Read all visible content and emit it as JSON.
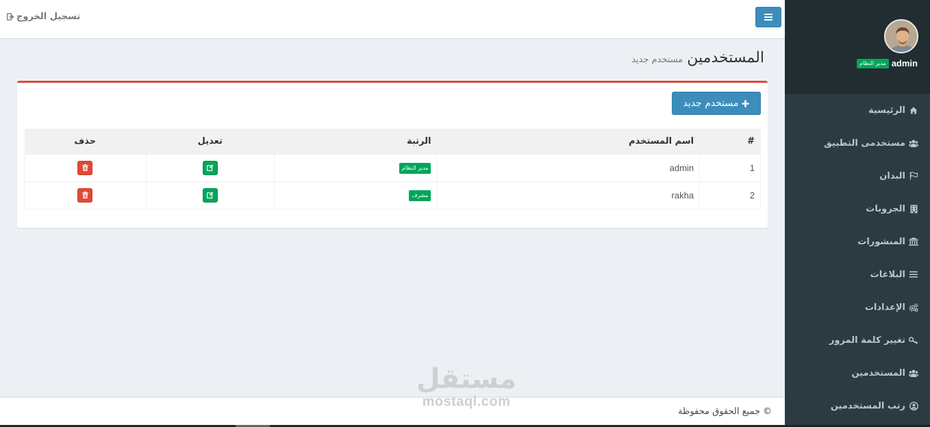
{
  "header": {
    "logout_label": "تسجيل الخروج"
  },
  "sidebar": {
    "user": {
      "name": "admin",
      "role_badge": "مدير النظام"
    },
    "items": [
      {
        "label": "الرئيسية",
        "icon": "home-icon"
      },
      {
        "label": "مستخدمى التطبيق",
        "icon": "users-icon"
      },
      {
        "label": "البدان",
        "icon": "flag-icon"
      },
      {
        "label": "الجروبات",
        "icon": "building-icon"
      },
      {
        "label": "المنشورات",
        "icon": "institution-icon"
      },
      {
        "label": "البلاغات",
        "icon": "list-icon"
      },
      {
        "label": "الإعدادات",
        "icon": "cogs-icon"
      },
      {
        "label": "تغيير كلمة المرور",
        "icon": "key-icon"
      },
      {
        "label": "المستخدمين",
        "icon": "users-icon"
      },
      {
        "label": "رتب المستخدمين",
        "icon": "user-circle-icon"
      }
    ]
  },
  "page": {
    "title": "المستخدمين",
    "subtitle": "مستخدم جديد"
  },
  "box": {
    "new_button_label": "مستخدم جديد",
    "table": {
      "headers": {
        "num": "#",
        "name": "اسم المستخدم",
        "rank": "الرتبة",
        "edit": "تعديل",
        "delete": "حذف"
      },
      "rows": [
        {
          "num": "1",
          "name": "admin",
          "rank": "مدير النظام"
        },
        {
          "num": "2",
          "name": "rakha",
          "rank": "مشرف"
        }
      ]
    }
  },
  "footer": {
    "text": "جميع الحقوق محفوظة"
  },
  "watermark": {
    "arabic": "مستقل",
    "latin": "mostaql.com"
  },
  "colors": {
    "sidebar": "#2c3b41",
    "primary": "#3c8dbc",
    "success": "#00a65a",
    "danger": "#dd4b39"
  }
}
